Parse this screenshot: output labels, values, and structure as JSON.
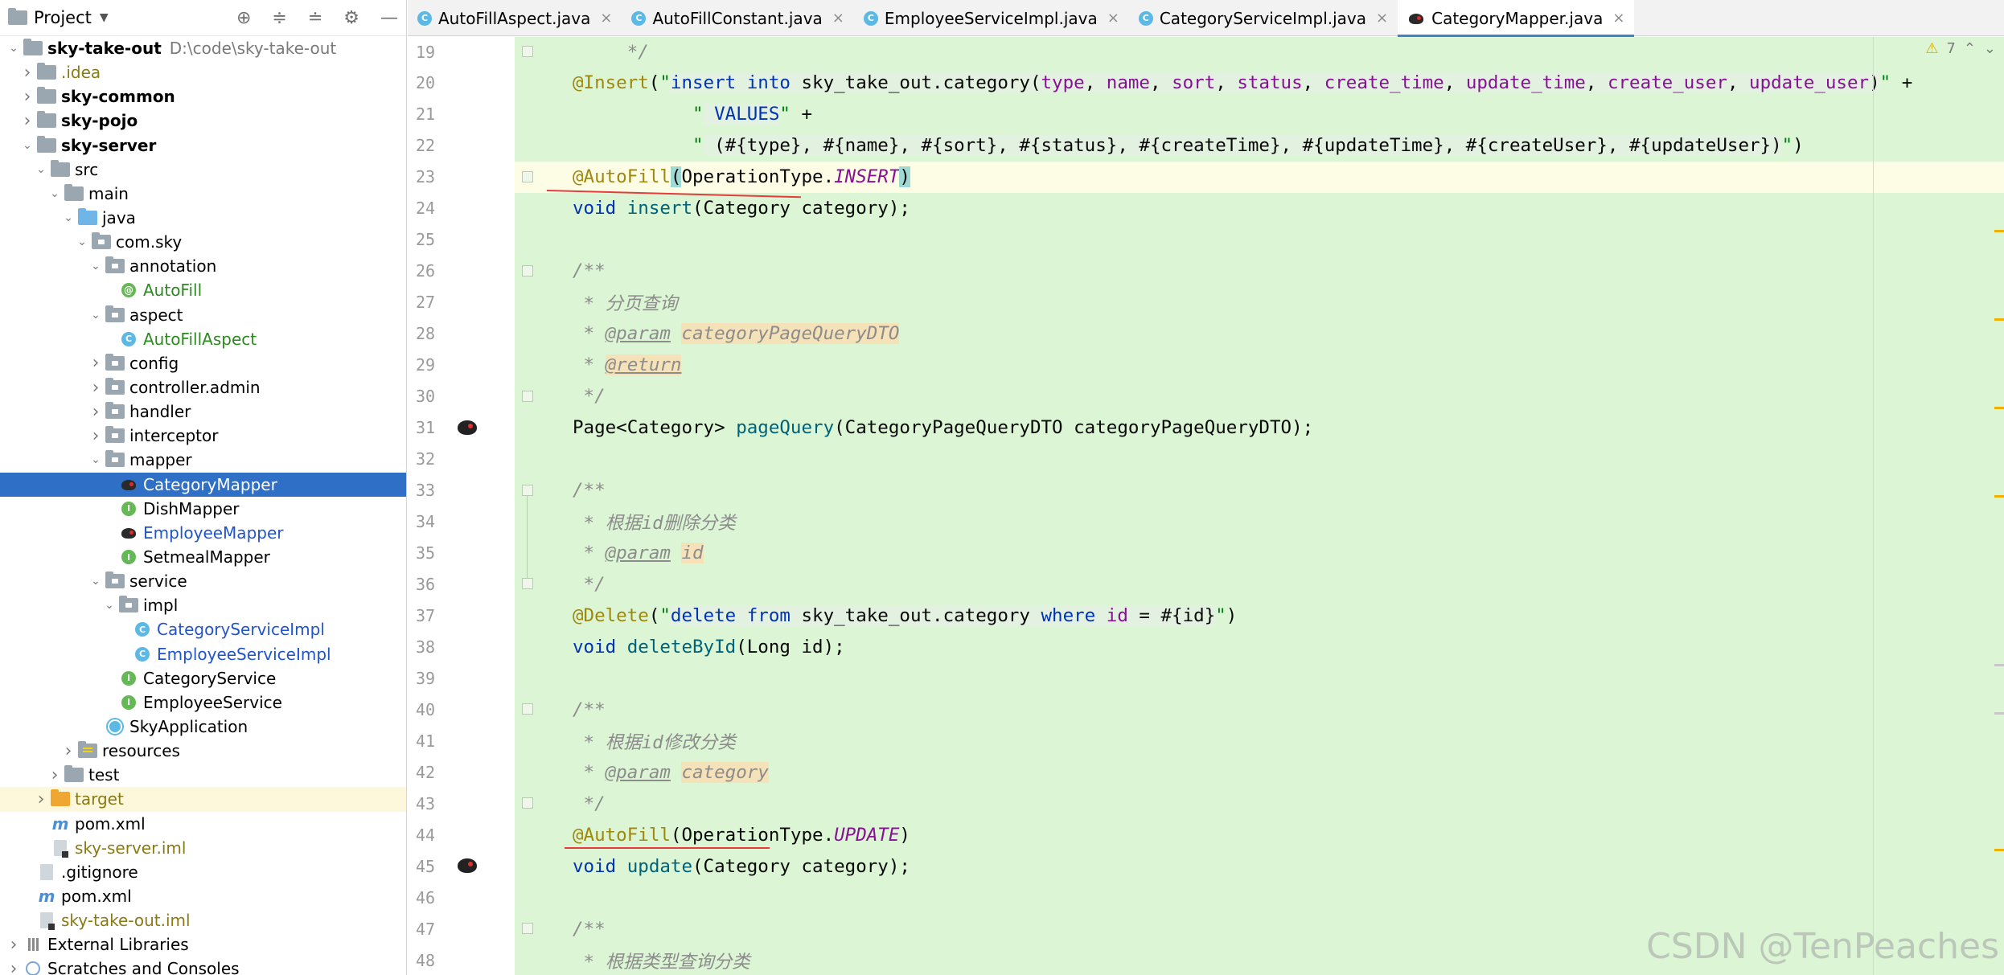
{
  "project_panel": {
    "title": "Project",
    "tree": [
      {
        "label": "sky-take-out",
        "path": "D:\\code\\sky-take-out",
        "depth": 0,
        "arrow": "down",
        "icon": "folder",
        "style": "bold"
      },
      {
        "label": ".idea",
        "depth": 1,
        "arrow": "right",
        "icon": "folder",
        "style": "olive"
      },
      {
        "label": "sky-common",
        "depth": 1,
        "arrow": "right",
        "icon": "module-folder",
        "style": "bold"
      },
      {
        "label": "sky-pojo",
        "depth": 1,
        "arrow": "right",
        "icon": "module-folder",
        "style": "bold"
      },
      {
        "label": "sky-server",
        "depth": 1,
        "arrow": "down",
        "icon": "module-folder",
        "style": "bold"
      },
      {
        "label": "src",
        "depth": 2,
        "arrow": "down",
        "icon": "folder",
        "style": ""
      },
      {
        "label": "main",
        "depth": 3,
        "arrow": "down",
        "icon": "folder",
        "style": ""
      },
      {
        "label": "java",
        "depth": 4,
        "arrow": "down",
        "icon": "folder-blue",
        "style": ""
      },
      {
        "label": "com.sky",
        "depth": 5,
        "arrow": "down",
        "icon": "package",
        "style": ""
      },
      {
        "label": "annotation",
        "depth": 6,
        "arrow": "down",
        "icon": "package",
        "style": ""
      },
      {
        "label": "AutoFill",
        "depth": 7,
        "arrow": "none",
        "icon": "annotation",
        "style": "green"
      },
      {
        "label": "aspect",
        "depth": 6,
        "arrow": "down",
        "icon": "package",
        "style": ""
      },
      {
        "label": "AutoFillAspect",
        "depth": 7,
        "arrow": "none",
        "icon": "class",
        "style": "green"
      },
      {
        "label": "config",
        "depth": 6,
        "arrow": "right",
        "icon": "package",
        "style": ""
      },
      {
        "label": "controller.admin",
        "depth": 6,
        "arrow": "right",
        "icon": "package",
        "style": ""
      },
      {
        "label": "handler",
        "depth": 6,
        "arrow": "right",
        "icon": "package",
        "style": ""
      },
      {
        "label": "interceptor",
        "depth": 6,
        "arrow": "right",
        "icon": "package",
        "style": ""
      },
      {
        "label": "mapper",
        "depth": 6,
        "arrow": "down",
        "icon": "package",
        "style": ""
      },
      {
        "label": "CategoryMapper",
        "depth": 7,
        "arrow": "none",
        "icon": "mybatis",
        "style": "selected"
      },
      {
        "label": "DishMapper",
        "depth": 7,
        "arrow": "none",
        "icon": "interface",
        "style": ""
      },
      {
        "label": "EmployeeMapper",
        "depth": 7,
        "arrow": "none",
        "icon": "mybatis",
        "style": "blue"
      },
      {
        "label": "SetmealMapper",
        "depth": 7,
        "arrow": "none",
        "icon": "interface",
        "style": ""
      },
      {
        "label": "service",
        "depth": 6,
        "arrow": "down",
        "icon": "package",
        "style": ""
      },
      {
        "label": "impl",
        "depth": 7,
        "arrow": "down",
        "icon": "package",
        "style": ""
      },
      {
        "label": "CategoryServiceImpl",
        "depth": 8,
        "arrow": "none",
        "icon": "class",
        "style": "blue"
      },
      {
        "label": "EmployeeServiceImpl",
        "depth": 8,
        "arrow": "none",
        "icon": "class",
        "style": "blue"
      },
      {
        "label": "CategoryService",
        "depth": 7,
        "arrow": "none",
        "icon": "interface",
        "style": ""
      },
      {
        "label": "EmployeeService",
        "depth": 7,
        "arrow": "none",
        "icon": "interface",
        "style": ""
      },
      {
        "label": "SkyApplication",
        "depth": 6,
        "arrow": "none",
        "icon": "app",
        "style": ""
      },
      {
        "label": "resources",
        "depth": 4,
        "arrow": "right",
        "icon": "resources",
        "style": ""
      },
      {
        "label": "test",
        "depth": 3,
        "arrow": "right",
        "icon": "folder",
        "style": ""
      },
      {
        "label": "target",
        "depth": 2,
        "arrow": "right",
        "icon": "folder-orange",
        "style": "olive-highlight"
      },
      {
        "label": "pom.xml",
        "depth": 2,
        "arrow": "none",
        "icon": "maven",
        "style": ""
      },
      {
        "label": "sky-server.iml",
        "depth": 2,
        "arrow": "none",
        "icon": "iml",
        "style": "olive"
      },
      {
        "label": ".gitignore",
        "depth": 1,
        "arrow": "none",
        "icon": "file",
        "style": ""
      },
      {
        "label": "pom.xml",
        "depth": 1,
        "arrow": "none",
        "icon": "maven",
        "style": ""
      },
      {
        "label": "sky-take-out.iml",
        "depth": 1,
        "arrow": "none",
        "icon": "iml",
        "style": "olive"
      },
      {
        "label": "External Libraries",
        "depth": 0,
        "arrow": "right",
        "icon": "libraries",
        "style": ""
      },
      {
        "label": "Scratches and Consoles",
        "depth": 0,
        "arrow": "right",
        "icon": "scratches",
        "style": ""
      }
    ]
  },
  "tabs": [
    {
      "label": "AutoFillAspect.java",
      "icon": "class",
      "active": false
    },
    {
      "label": "AutoFillConstant.java",
      "icon": "class",
      "active": false
    },
    {
      "label": "EmployeeServiceImpl.java",
      "icon": "class",
      "active": false
    },
    {
      "label": "CategoryServiceImpl.java",
      "icon": "class",
      "active": false
    },
    {
      "label": "CategoryMapper.java",
      "icon": "mybatis",
      "active": true
    }
  ],
  "inspections": {
    "warnings": "7"
  },
  "code_lines": [
    {
      "n": "19",
      "segs": [
        [
          "cm",
          "     */"
        ]
      ]
    },
    {
      "n": "20",
      "segs": [
        [
          "an",
          "@Insert"
        ],
        [
          "plain",
          "("
        ],
        [
          "str",
          "\""
        ],
        [
          "strbg kw",
          "insert into"
        ],
        [
          "strbg plain",
          " sky_take_out.category("
        ],
        [
          "strbg fld",
          "type"
        ],
        [
          "strbg plain",
          ", "
        ],
        [
          "strbg fld",
          "name"
        ],
        [
          "strbg plain",
          ", "
        ],
        [
          "strbg fld",
          "sort"
        ],
        [
          "strbg plain",
          ", "
        ],
        [
          "strbg fld",
          "status"
        ],
        [
          "strbg plain",
          ", "
        ],
        [
          "strbg fld",
          "create_time"
        ],
        [
          "strbg plain",
          ", "
        ],
        [
          "strbg fld",
          "update_time"
        ],
        [
          "strbg plain",
          ", "
        ],
        [
          "strbg fld",
          "create_user"
        ],
        [
          "strbg plain",
          ", "
        ],
        [
          "strbg fld",
          "update_user"
        ],
        [
          "strbg plain",
          ")"
        ],
        [
          "str",
          "\""
        ],
        [
          "plain",
          " +"
        ]
      ]
    },
    {
      "n": "21",
      "segs": [
        [
          "plain",
          "           "
        ],
        [
          "str",
          "\""
        ],
        [
          "strbg kw",
          " VALUES"
        ],
        [
          "str",
          "\""
        ],
        [
          "plain",
          " +"
        ]
      ]
    },
    {
      "n": "22",
      "segs": [
        [
          "plain",
          "           "
        ],
        [
          "str",
          "\""
        ],
        [
          "strbg plain",
          " (#{type}, #{name}, #{sort}, #{status}, #{createTime}, #{updateTime}, #{createUser}, #{updateUser})"
        ],
        [
          "str",
          "\""
        ],
        [
          "plain",
          ")"
        ]
      ]
    },
    {
      "n": "23",
      "segs": [
        [
          "an",
          "@AutoFill"
        ],
        [
          "paren-hl plain",
          "("
        ],
        [
          "plain",
          "OperationType."
        ],
        [
          "ital",
          "INSERT"
        ],
        [
          "paren-hl plain",
          ")"
        ]
      ]
    },
    {
      "n": "24",
      "segs": [
        [
          "kw",
          "void"
        ],
        [
          "plain",
          " "
        ],
        [
          "fn",
          "insert"
        ],
        [
          "plain",
          "(Category category);"
        ]
      ]
    },
    {
      "n": "25",
      "segs": []
    },
    {
      "n": "26",
      "segs": [
        [
          "cm",
          "/**"
        ]
      ]
    },
    {
      "n": "27",
      "segs": [
        [
          "cm",
          " * 分页查询"
        ]
      ]
    },
    {
      "n": "28",
      "segs": [
        [
          "cm",
          " * "
        ],
        [
          "tag",
          "@param"
        ],
        [
          "cm",
          " "
        ],
        [
          "tagbg cm",
          "categoryPageQueryDTO"
        ]
      ]
    },
    {
      "n": "29",
      "segs": [
        [
          "cm",
          " * "
        ],
        [
          "tagbg tag",
          "@return"
        ]
      ]
    },
    {
      "n": "30",
      "segs": [
        [
          "cm",
          " */"
        ]
      ]
    },
    {
      "n": "31",
      "segs": [
        [
          "plain",
          "Page<Category> "
        ],
        [
          "fn",
          "pageQuery"
        ],
        [
          "plain",
          "(CategoryPageQueryDTO categoryPageQueryDTO);"
        ]
      ]
    },
    {
      "n": "32",
      "segs": []
    },
    {
      "n": "33",
      "segs": [
        [
          "cm",
          "/**"
        ]
      ]
    },
    {
      "n": "34",
      "segs": [
        [
          "cm",
          " * 根据id删除分类"
        ]
      ]
    },
    {
      "n": "35",
      "segs": [
        [
          "cm",
          " * "
        ],
        [
          "tag",
          "@param"
        ],
        [
          "cm",
          " "
        ],
        [
          "tagbg cm",
          "id"
        ]
      ]
    },
    {
      "n": "36",
      "segs": [
        [
          "cm",
          " */"
        ]
      ]
    },
    {
      "n": "37",
      "segs": [
        [
          "an",
          "@Delete"
        ],
        [
          "plain",
          "("
        ],
        [
          "str",
          "\""
        ],
        [
          "strbg kw",
          "delete from"
        ],
        [
          "strbg plain",
          " sky_take_out.category "
        ],
        [
          "strbg kw",
          "where"
        ],
        [
          "strbg plain",
          " "
        ],
        [
          "strbg fld",
          "id"
        ],
        [
          "strbg plain",
          " = #{id}"
        ],
        [
          "str",
          "\""
        ],
        [
          "plain",
          ")"
        ]
      ]
    },
    {
      "n": "38",
      "segs": [
        [
          "kw",
          "void"
        ],
        [
          "plain",
          " "
        ],
        [
          "fn",
          "deleteById"
        ],
        [
          "plain",
          "(Long id);"
        ]
      ]
    },
    {
      "n": "39",
      "segs": []
    },
    {
      "n": "40",
      "segs": [
        [
          "cm",
          "/**"
        ]
      ]
    },
    {
      "n": "41",
      "segs": [
        [
          "cm",
          " * 根据id修改分类"
        ]
      ]
    },
    {
      "n": "42",
      "segs": [
        [
          "cm",
          " * "
        ],
        [
          "tag",
          "@param"
        ],
        [
          "cm",
          " "
        ],
        [
          "tagbg cm",
          "category"
        ]
      ]
    },
    {
      "n": "43",
      "segs": [
        [
          "cm",
          " */"
        ]
      ]
    },
    {
      "n": "44",
      "segs": [
        [
          "an",
          "@AutoFill"
        ],
        [
          "plain",
          "(OperationType."
        ],
        [
          "ital",
          "UPDATE"
        ],
        [
          "plain",
          ")"
        ]
      ]
    },
    {
      "n": "45",
      "segs": [
        [
          "kw",
          "void"
        ],
        [
          "plain",
          " "
        ],
        [
          "fn",
          "update"
        ],
        [
          "plain",
          "(Category category);"
        ]
      ]
    },
    {
      "n": "46",
      "segs": []
    },
    {
      "n": "47",
      "segs": [
        [
          "cm",
          "/**"
        ]
      ]
    },
    {
      "n": "48",
      "segs": [
        [
          "cm",
          " * 根据类型查询分类"
        ]
      ]
    }
  ],
  "watermark": "CSDN @TenPeaches"
}
